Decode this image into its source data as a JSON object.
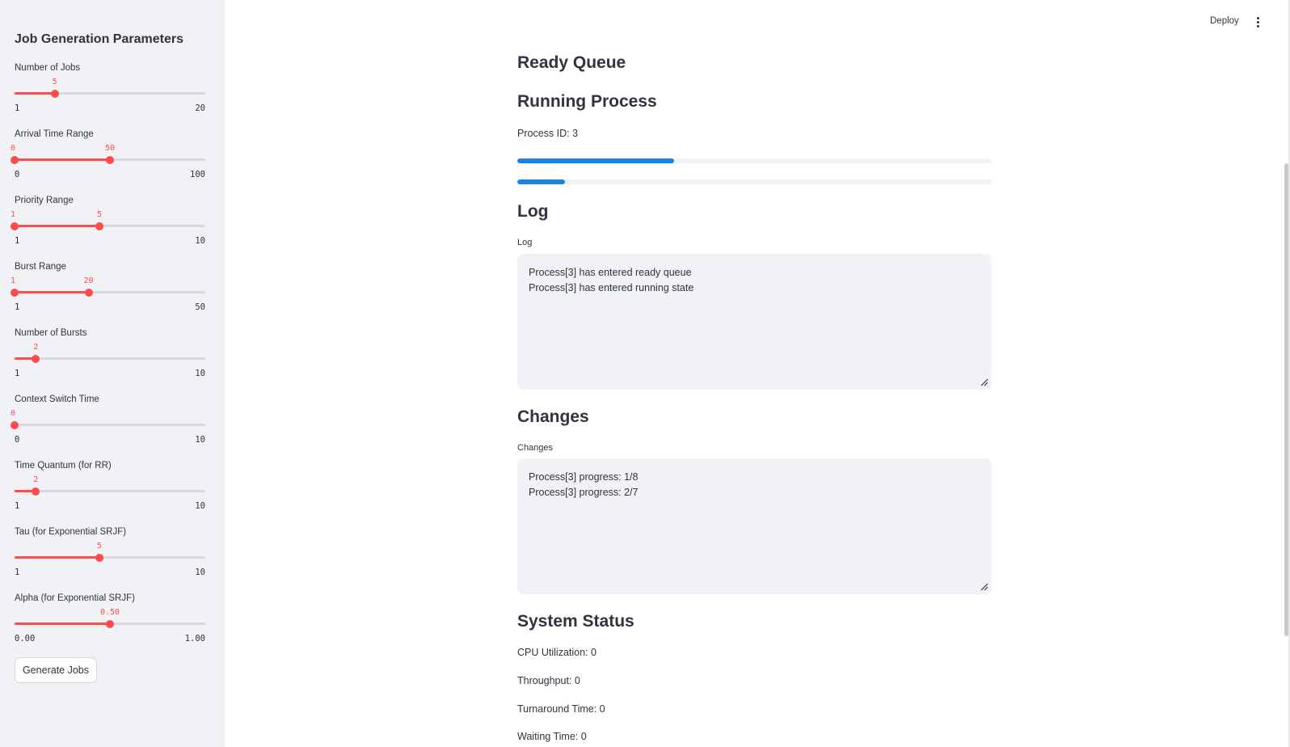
{
  "header": {
    "deploy_label": "Deploy",
    "menu_icon": "kebab-menu-icon"
  },
  "sidebar": {
    "title": "Job Generation Parameters",
    "sliders": [
      {
        "label": "Number of Jobs",
        "min": 1,
        "max": 20,
        "min_label": "1",
        "max_label": "20",
        "values": [
          5
        ],
        "value_labels": [
          "5"
        ]
      },
      {
        "label": "Arrival Time Range",
        "min": 0,
        "max": 100,
        "min_label": "0",
        "max_label": "100",
        "values": [
          0,
          50
        ],
        "value_labels": [
          "0",
          "50"
        ]
      },
      {
        "label": "Priority Range",
        "min": 1,
        "max": 10,
        "min_label": "1",
        "max_label": "10",
        "values": [
          1,
          5
        ],
        "value_labels": [
          "1",
          "5"
        ]
      },
      {
        "label": "Burst Range",
        "min": 1,
        "max": 50,
        "min_label": "1",
        "max_label": "50",
        "values": [
          1,
          20
        ],
        "value_labels": [
          "1",
          "20"
        ]
      },
      {
        "label": "Number of Bursts",
        "min": 1,
        "max": 10,
        "min_label": "1",
        "max_label": "10",
        "values": [
          2
        ],
        "value_labels": [
          "2"
        ]
      },
      {
        "label": "Context Switch Time",
        "min": 0,
        "max": 10,
        "min_label": "0",
        "max_label": "10",
        "values": [
          0
        ],
        "value_labels": [
          "0"
        ]
      },
      {
        "label": "Time Quantum (for RR)",
        "min": 1,
        "max": 10,
        "min_label": "1",
        "max_label": "10",
        "values": [
          2
        ],
        "value_labels": [
          "2"
        ]
      },
      {
        "label": "Tau (for Exponential SRJF)",
        "min": 1,
        "max": 10,
        "min_label": "1",
        "max_label": "10",
        "values": [
          5
        ],
        "value_labels": [
          "5"
        ]
      },
      {
        "label": "Alpha (for Exponential SRJF)",
        "min": 0,
        "max": 1,
        "min_label": "0.00",
        "max_label": "1.00",
        "values": [
          0.5
        ],
        "value_labels": [
          "0.50"
        ]
      }
    ],
    "generate_button": "Generate Jobs"
  },
  "main": {
    "ready_queue_title": "Ready Queue",
    "running_title": "Running Process",
    "process_id_text": "Process ID: 3",
    "progress_bars": [
      0.33,
      0.1
    ],
    "log_title": "Log",
    "log_label": "Log",
    "log_lines": [
      "Process[3] has entered ready queue",
      "Process[3] has entered running state"
    ],
    "changes_title": "Changes",
    "changes_label": "Changes",
    "changes_lines": [
      "Process[3] progress: 1/8",
      "Process[3] progress: 2/7"
    ],
    "status_title": "System Status",
    "status_lines": [
      "CPU Utilization: 0",
      "Throughput: 0",
      "Turnaround Time: 0",
      "Waiting Time: 0"
    ]
  },
  "colors": {
    "accent": "#ff4b4b",
    "progress": "#1c83e1",
    "sidebar_bg": "#f0f2f6",
    "text": "#31333f"
  }
}
